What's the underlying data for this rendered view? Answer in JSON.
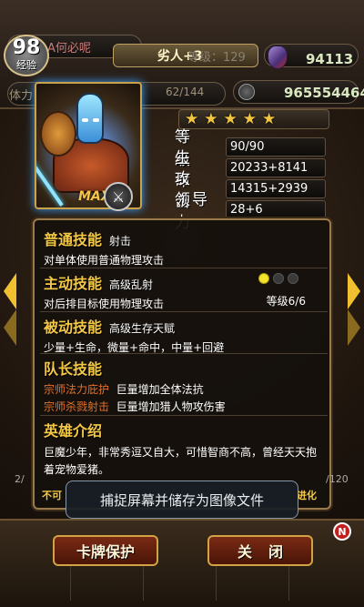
{
  "header": {
    "avatar_number": "98",
    "avatar_label": "经验",
    "player_name": "A何必呢",
    "rank_tag": "劣人+3",
    "level_faded": "等级：129",
    "gems": "94113",
    "stamina_label": "体力",
    "stamina_value": "62/144",
    "coins": "965554464"
  },
  "hero": {
    "max_badge": "MAX",
    "stars": 5,
    "stats": [
      {
        "label": "等　级",
        "value": "90/90"
      },
      {
        "label": "生　命",
        "value": "20233+8141"
      },
      {
        "label": "攻　击",
        "value": "14315+2939"
      },
      {
        "label": "领导力",
        "value": "28+6"
      }
    ]
  },
  "skills": {
    "normal": {
      "title": "普通技能",
      "name": "射击",
      "desc": "对单体使用普通物理攻击"
    },
    "active": {
      "title": "主动技能",
      "name": "高级乱射",
      "desc": "对后排目标使用物理攻击",
      "level": "等级6/6",
      "dots_on": 1,
      "dots_total": 3
    },
    "passive": {
      "title": "被动技能",
      "name": "高级生存天赋",
      "desc": "少量+生命，微量+命中，中量+回避"
    },
    "leader": {
      "title": "队长技能",
      "items": [
        {
          "name": "宗师法力庇护",
          "desc": "巨量增加全体法抗"
        },
        {
          "name": "宗师杀戮射击",
          "desc": "巨量增加猎人物攻伤害"
        }
      ]
    },
    "intro": {
      "title": "英雄介绍",
      "text": "巨魔少年，非常秀逗又自大，可惜智商不高，曾经天天抱着宠物爱猪。"
    }
  },
  "panel_footer": {
    "left": "不可",
    "right": "进化"
  },
  "page": {
    "left": "2/",
    "right": "/120"
  },
  "toast": "捕捉屏幕并储存为图像文件",
  "buttons": {
    "protect": "卡牌保护",
    "close": "关闭"
  },
  "nav": {
    "n_badge": "N"
  },
  "colors": {
    "accent_gold": "#f4c843",
    "leader_skill": "#e4722a",
    "dot_on": "#f3e32a"
  }
}
